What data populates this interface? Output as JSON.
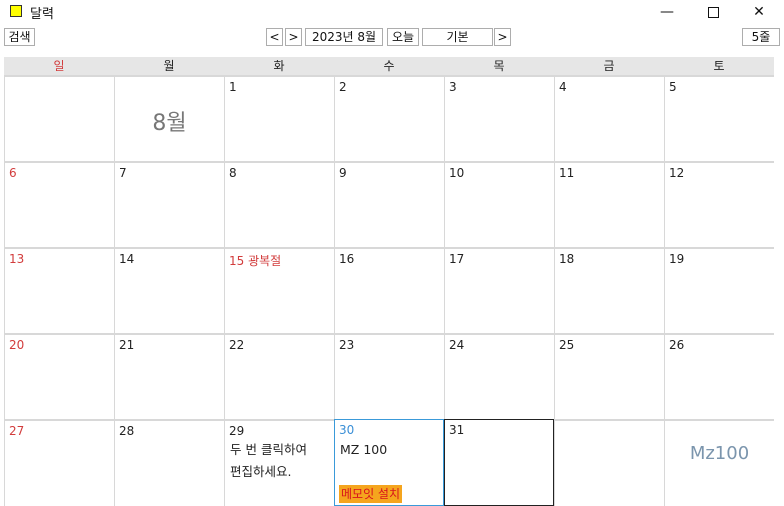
{
  "window": {
    "title": "달력",
    "minimize": "—",
    "close": "✕"
  },
  "toolbar": {
    "search": "검색",
    "prev": "<",
    "next": ">",
    "month": "2023년 8월",
    "today": "오늘",
    "view": "기본",
    "view_next": ">",
    "rows": "5줄"
  },
  "weekdays": [
    "일",
    "월",
    "화",
    "수",
    "목",
    "금",
    "토"
  ],
  "month_label": "8월",
  "weeks": [
    [
      "",
      "",
      "1",
      "2",
      "3",
      "4",
      "5"
    ],
    [
      "6",
      "7",
      "8",
      "9",
      "10",
      "11",
      "12"
    ],
    [
      "13",
      "14",
      "15 광복절",
      "16",
      "17",
      "18",
      "19"
    ],
    [
      "20",
      "21",
      "22",
      "23",
      "24",
      "25",
      "26"
    ],
    [
      "27",
      "28",
      "29",
      "30",
      "31",
      "",
      ""
    ]
  ],
  "notes": {
    "edit_hint_line1": "두 번 클릭하여",
    "edit_hint_line2": "편집하세요.",
    "mz_entry": "MZ 100",
    "memo_install": "메모잇 설치",
    "brand": "Mz100"
  },
  "colors": {
    "sunday": "#d23c3c",
    "today": "#3a8fd6",
    "memo_bg": "#f5a51e",
    "memo_text": "#d8141c",
    "app_icon": "#ffff00"
  }
}
